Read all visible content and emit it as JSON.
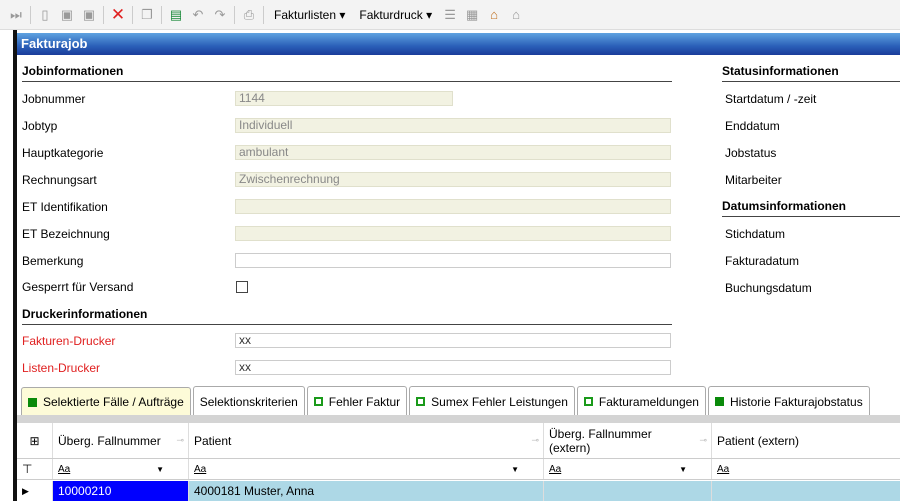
{
  "toolbar": {
    "menus": [
      "Fakturlisten",
      "Fakturdruck"
    ]
  },
  "title": "Fakturajob",
  "job": {
    "heading": "Jobinformationen",
    "rows": [
      {
        "label": "Jobnummer",
        "value": "1144"
      },
      {
        "label": "Jobtyp",
        "value": "Individuell"
      },
      {
        "label": "Hauptkategorie",
        "value": "ambulant"
      },
      {
        "label": "Rechnungsart",
        "value": "Zwischenrechnung"
      },
      {
        "label": "ET Identifikation",
        "value": ""
      },
      {
        "label": "ET Bezeichnung",
        "value": ""
      },
      {
        "label": "Bemerkung",
        "value": ""
      }
    ],
    "locked_label": "Gesperrt für Versand",
    "locked": false
  },
  "printer": {
    "heading": "Druckerinformationen",
    "invoice_label": "Fakturen-Drucker",
    "invoice_value": "xx",
    "list_label": "Listen-Drucker",
    "list_value": "xx"
  },
  "status": {
    "heading": "Statusinformationen",
    "items": [
      "Startdatum / -zeit",
      "Enddatum",
      "Jobstatus",
      "Mitarbeiter"
    ]
  },
  "dates": {
    "heading": "Datumsinformationen",
    "items": [
      "Stichdatum",
      "Fakturadatum",
      "Buchungsdatum"
    ]
  },
  "tabs": [
    {
      "label": "Selektierte Fälle / Aufträge",
      "icon": "filled"
    },
    {
      "label": "Selektionskriterien",
      "icon": "none"
    },
    {
      "label": "Fehler Faktur",
      "icon": "outline"
    },
    {
      "label": "Sumex Fehler Leistungen",
      "icon": "outline"
    },
    {
      "label": "Fakturameldungen",
      "icon": "outline"
    },
    {
      "label": "Historie Fakturajobstatus",
      "icon": "filled"
    }
  ],
  "grid": {
    "columns": [
      "Überg. Fallnummer",
      "Patient",
      "Überg. Fallnummer (extern)",
      "Patient (extern)"
    ],
    "filter": "Aa",
    "rows": [
      {
        "fallnummer": "10000210",
        "patient": "4000181 Muster, Anna",
        "fall_extern": "",
        "patient_extern": ""
      }
    ]
  }
}
